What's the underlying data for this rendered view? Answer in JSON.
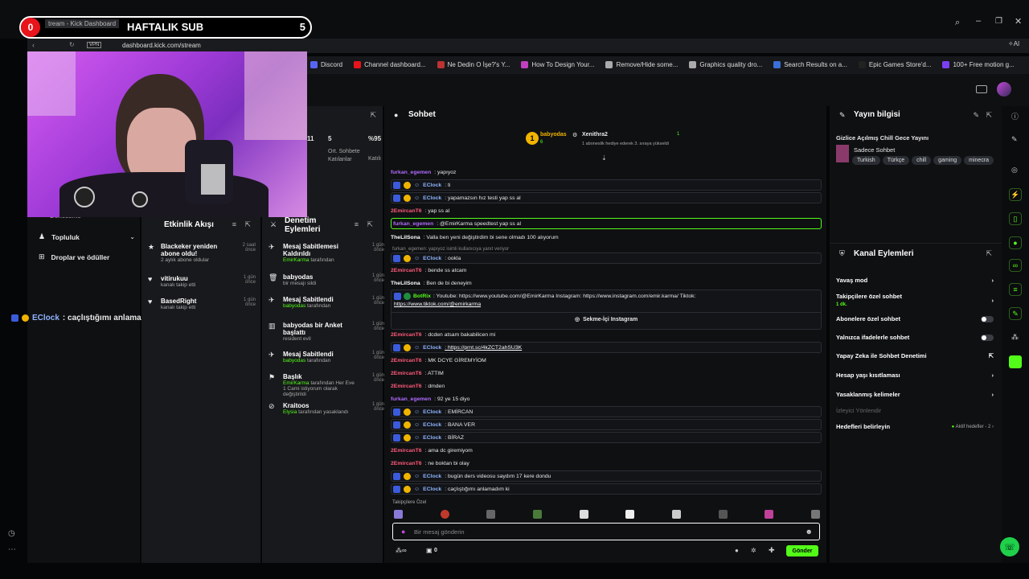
{
  "browser": {
    "tab_title": "tream - Kick Dashboard",
    "url": "dashboard.kick.com/stream",
    "vpn": "VPN",
    "bookmarks": [
      "Discord",
      "Channel dashboard...",
      "Ne Dedin O İşe?'s Y...",
      "How To Design Your...",
      "Remove/Hide some...",
      "Graphics quality dro...",
      "Search Results on a...",
      "Epic Games Store'd...",
      "100+ Free motion g..."
    ]
  },
  "sub_banner": {
    "count": "0",
    "title": "HAFTALIK SUB",
    "goal": "5"
  },
  "overlay_chat": {
    "user": "EClock",
    "text": ": caçlıştığımı anlamadım ki"
  },
  "left_nav": {
    "items": [
      "Topluluk",
      "Droplar ve ödüller"
    ],
    "partial": "Denetleme"
  },
  "stats": {
    "v1": "11",
    "v2": "5",
    "v3": "%95",
    "l2": "Ort. Sohbete Katılanlar",
    "l3": "Katılı"
  },
  "activity": {
    "title": "Etkinlik Akışı",
    "items": [
      {
        "name": "Blackeker yeniden abone oldu!",
        "sub": "2 aylık abone oldular",
        "time": "2 saat önce"
      },
      {
        "name": "vitirukuu",
        "sub": "kanalı takip etti",
        "time": "1 gün önce"
      },
      {
        "name": "BasedRight",
        "sub": "kanalı takip etti",
        "time": "1 gün önce"
      }
    ]
  },
  "moderation": {
    "title": "Denetim Eylemleri",
    "items": [
      {
        "title": "Mesaj Sabitlemesi Kaldırıldı",
        "sub_user": "EmirKarma",
        "sub": " tarafından",
        "time": "1 gün önce"
      },
      {
        "title": "babyodas",
        "sub_user": "",
        "sub": "bir mesajı sildi",
        "time": "1 gün önce"
      },
      {
        "title": "Mesaj Sabitlendi",
        "sub_user": "babyodas",
        "sub": " tarafından",
        "time": "1 gün önce"
      },
      {
        "title": "babyodas bir Anket başlattı",
        "sub_user": "",
        "sub": "resident evil",
        "time": "1 gün önce"
      },
      {
        "title": "Mesaj Sabitlendi",
        "sub_user": "babyodas",
        "sub": " tarafından",
        "time": "1 gün önce"
      },
      {
        "title": "Başlık",
        "sub_user": "EmirKarma",
        "sub": " tarafından Her Eve 1 Cami istiyorum olarak değiştirildi",
        "time": "1 gün önce"
      },
      {
        "title": "Kraitoos",
        "sub_user": "Elysia",
        "sub": " tarafından yasaklandı",
        "time": "1 gün önce"
      }
    ]
  },
  "chat": {
    "title": "Sohbet",
    "leader_user": "babyodas",
    "leader_count": "6",
    "gifter": "Xenithra2",
    "gifter_sub": "1 aboneslik hediye ederek 3. sıraya yükseldi",
    "gifter_count": "1",
    "messages": [
      {
        "u": "furkan_egemen",
        "c": "#b06bff",
        "t": ": yapıyoz",
        "style": "plain"
      },
      {
        "u": "EClock",
        "c": "#8fb4ff",
        "t": ": ti",
        "style": "box"
      },
      {
        "u": "EClock",
        "c": "#8fb4ff",
        "t": ": yapamazsın hız testi yap ss al",
        "style": "box"
      },
      {
        "u": "2EmircanT6",
        "c": "#ff5a7a",
        "t": ": yap ss al",
        "style": "plain"
      },
      {
        "u": "furkan_egemen",
        "c": "#b06bff",
        "t": ": @EmirKarma speedtest yap ss al",
        "style": "hl"
      },
      {
        "u": "TheLilSona",
        "c": "#ffffff",
        "t": ": Valla ben yeni değiştirdim bi sene olmadı 100 alıyorum",
        "style": "plain"
      },
      {
        "u": "EClock",
        "c": "#8fb4ff",
        "t": ": ookla",
        "style": "box"
      },
      {
        "u": "2EmircanT6",
        "c": "#ff5a7a",
        "t": ": bende ss atcam",
        "style": "plain"
      },
      {
        "u": "TheLilSona",
        "c": "#ffffff",
        "t": ": Ben de bi deneyim",
        "style": "plain"
      },
      {
        "u": "2EmircanT6",
        "c": "#ff5a7a",
        "t": ": dcden atsam bakabilicen mi",
        "style": "plain"
      },
      {
        "u": "EClock",
        "c": "#8fb4ff",
        "t": ": https://prnt.sc/4kZCT2ahSU3K",
        "style": "box"
      },
      {
        "u": "2EmircanT6",
        "c": "#ff5a7a",
        "t": ": MK DCYE GİREMYİOM",
        "style": "plain"
      },
      {
        "u": "2EmircanT6",
        "c": "#ff5a7a",
        "t": ": ATTIM",
        "style": "plain"
      },
      {
        "u": "2EmircanT6",
        "c": "#ff5a7a",
        "t": ": dmden",
        "style": "plain"
      },
      {
        "u": "furkan_egemen",
        "c": "#b06bff",
        "t": ": 92 ye 15 diyo",
        "style": "plain"
      },
      {
        "u": "EClock",
        "c": "#8fb4ff",
        "t": ": EMİRCAN",
        "style": "box"
      },
      {
        "u": "EClock",
        "c": "#8fb4ff",
        "t": ": BANA VER",
        "style": "box"
      },
      {
        "u": "EClock",
        "c": "#8fb4ff",
        "t": ": BİRAZ",
        "style": "box"
      },
      {
        "u": "2EmircanT6",
        "c": "#ff5a7a",
        "t": ": ama dc giremiyom",
        "style": "plain"
      },
      {
        "u": "2EmircanT6",
        "c": "#ff5a7a",
        "t": ": ne boktan bi olay",
        "style": "plain"
      },
      {
        "u": "EClock",
        "c": "#8fb4ff",
        "t": ": bugün ders videosu saydım 17 kere dondu",
        "style": "box"
      },
      {
        "u": "EClock",
        "c": "#8fb4ff",
        "t": ": caçlıştığımı anlamadım ki",
        "style": "box"
      }
    ],
    "reply_hint": "furkan_egemen: yapıyoz isimli kullanıcıya yanıt veriyor",
    "botrix_user": "BotRix",
    "botrix_text": ": Youtube: https://www.youtube.com/@EmirKarma Instagram: https://www.instagram.com/emir.karma/ Tiktok:",
    "botrix_text2": "https://www.tiktok.com/@emirkarma",
    "tab_instagram": "Sekme-İçi Instagram",
    "followers_only": "Takipçilere Özel",
    "input_placeholder": "Bir mesaj gönderin",
    "viewer_count": "0",
    "send_label": "Gönder"
  },
  "stream_info": {
    "title": "Yayın bilgisi",
    "stream_title": "Gizlice Açılmış Chill Gece Yayını",
    "category": "Sadece Sohbet",
    "tags": [
      "Turkish",
      "Türkçe",
      "chill",
      "gaming",
      "minecra"
    ]
  },
  "channel_actions": {
    "title": "Kanal Eylemleri",
    "slow_mode": "Yavaş mod",
    "followers_chat": "Takipçilere özel sohbet",
    "followers_sub": "1 dk.",
    "subs_chat": "Abonelere özel sohbet",
    "emotes_chat": "Yalnızca ifadelerle sohbet",
    "ai_mod": "Yapay Zeka ile Sohbet Denetimi",
    "age_limit": "Hesap yaşı kısıtlaması",
    "banned_words": "Yasaklanmış kelimeler",
    "viewer_redirect": "İzleyici Yönlendir",
    "set_targets": "Hedefleri belirleyin",
    "active_targets": "Aktif hedefler - 2"
  }
}
